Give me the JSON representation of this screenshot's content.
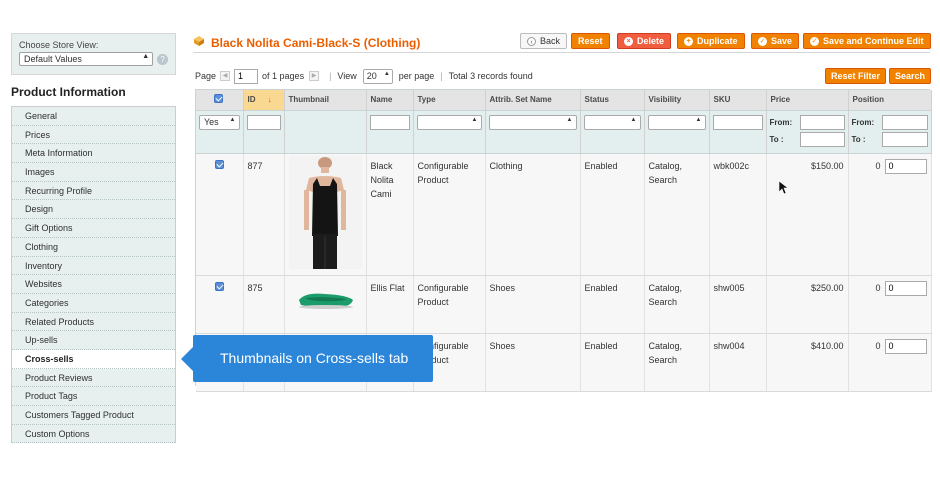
{
  "sidebar": {
    "store_view_label": "Choose Store View:",
    "store_view_value": "Default Values",
    "section_title": "Product Information",
    "items": [
      {
        "label": "General"
      },
      {
        "label": "Prices"
      },
      {
        "label": "Meta Information"
      },
      {
        "label": "Images"
      },
      {
        "label": "Recurring Profile"
      },
      {
        "label": "Design"
      },
      {
        "label": "Gift Options"
      },
      {
        "label": "Clothing"
      },
      {
        "label": "Inventory"
      },
      {
        "label": "Websites"
      },
      {
        "label": "Categories"
      },
      {
        "label": "Related Products"
      },
      {
        "label": "Up-sells"
      },
      {
        "label": "Cross-sells"
      },
      {
        "label": "Product Reviews"
      },
      {
        "label": "Product Tags"
      },
      {
        "label": "Customers Tagged Product"
      },
      {
        "label": "Custom Options"
      }
    ],
    "active_item": "Cross-sells"
  },
  "header": {
    "title": "Black Nolita Cami-Black-S (Clothing)",
    "buttons": {
      "back": "Back",
      "reset": "Reset",
      "delete": "Delete",
      "duplicate": "Duplicate",
      "save": "Save",
      "save_continue": "Save and Continue Edit"
    }
  },
  "pager": {
    "page_label": "Page",
    "page_value": "1",
    "of_pages": "of 1 pages",
    "view_label": "View",
    "view_value": "20",
    "per_page": "per page",
    "total": "Total 3 records found",
    "reset_filter": "Reset Filter",
    "search": "Search"
  },
  "grid": {
    "columns": [
      "",
      "ID",
      "Thumbnail",
      "Name",
      "Type",
      "Attrib. Set Name",
      "Status",
      "Visibility",
      "SKU",
      "Price",
      "Position"
    ],
    "filter": {
      "select_value": "Yes",
      "from_label": "From:",
      "to_label": "To :"
    },
    "rows": [
      {
        "id": "877",
        "name": "Black Nolita Cami",
        "type": "Configurable Product",
        "attrib_set": "Clothing",
        "status": "Enabled",
        "visibility": "Catalog, Search",
        "sku": "wbk002c",
        "price": "$150.00",
        "position": "0",
        "position_input": "0",
        "thumb": "black-cami-top"
      },
      {
        "id": "875",
        "name": "Ellis Flat",
        "type": "Configurable Product",
        "attrib_set": "Shoes",
        "status": "Enabled",
        "visibility": "Catalog, Search",
        "sku": "shw005",
        "price": "$250.00",
        "position": "0",
        "position_input": "0",
        "thumb": "green-flat-shoe"
      },
      {
        "id": "",
        "name": "",
        "type": "Configurable Product",
        "attrib_set": "Shoes",
        "status": "Enabled",
        "visibility": "Catalog, Search",
        "sku": "shw004",
        "price": "$410.00",
        "position": "0",
        "position_input": "0",
        "thumb": ""
      }
    ]
  },
  "tooltip": {
    "text": "Thumbnails on Cross-sells tab"
  },
  "colors": {
    "accent": "#f18200",
    "title": "#eb5e00",
    "tooltip": "#2b86d9",
    "filter_bg": "#e3efef"
  }
}
